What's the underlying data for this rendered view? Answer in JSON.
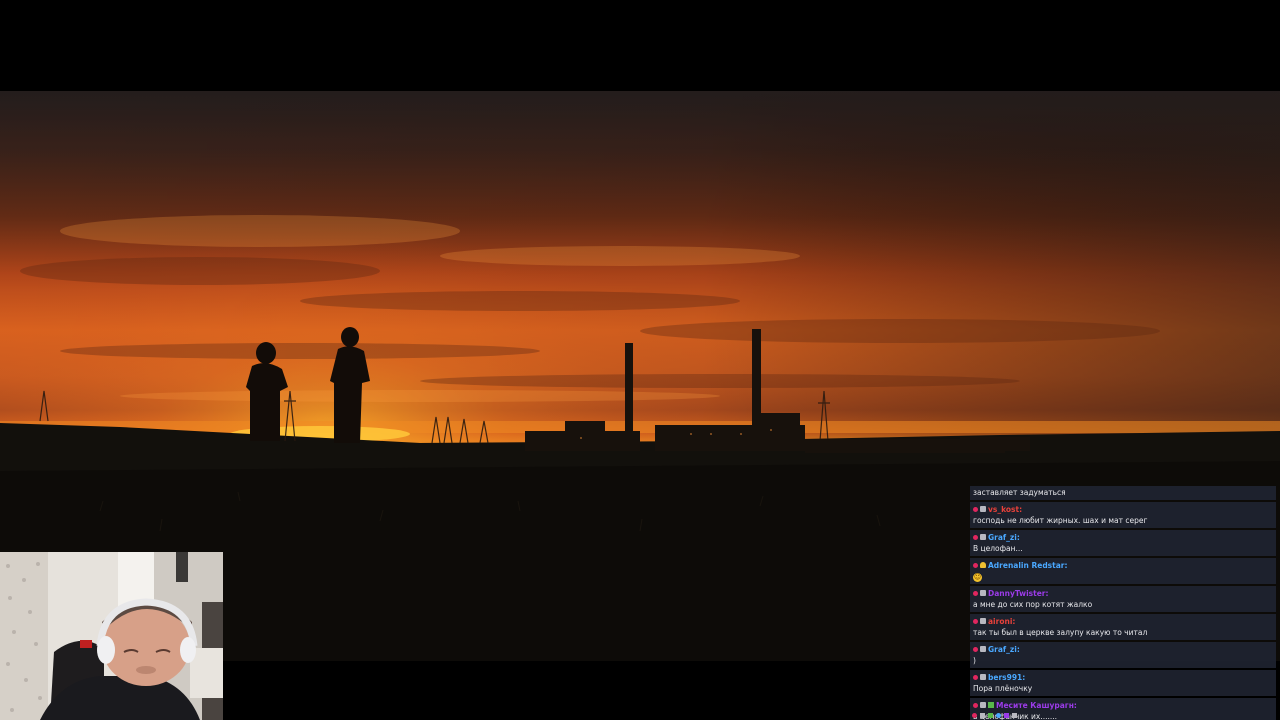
{
  "video": {
    "scene": "sunset-industrial"
  },
  "chat": {
    "messages": [
      {
        "user": "",
        "user_color": "#e8e8ec",
        "text": "заставляет задуматься",
        "badges": []
      },
      {
        "user": "vs_kost:",
        "user_color": "#e8413a",
        "text": "господь не любит жирных. шах и мат серег",
        "badges": [
          "dot",
          "sq"
        ]
      },
      {
        "user": "Graf_zi:",
        "user_color": "#4aa8ff",
        "text": "В целофан...",
        "badges": [
          "dot",
          "sq"
        ]
      },
      {
        "user": "Adrenalin Redstar:",
        "user_color": "#4aa8ff",
        "text": "",
        "emote": "😄",
        "badges": [
          "dot",
          "cap"
        ]
      },
      {
        "user": "DannyTwister:",
        "user_color": "#9b3be8",
        "text": "а мне до сих пор котят жалко",
        "badges": [
          "dot",
          "sq"
        ]
      },
      {
        "user": "aironi:",
        "user_color": "#e8413a",
        "text": "так ты был в церкве залупу какую то читал",
        "badges": [
          "dot",
          "sq"
        ]
      },
      {
        "user": "Graf_zi:",
        "user_color": "#4aa8ff",
        "text": ")",
        "badges": [
          "dot",
          "sq"
        ]
      },
      {
        "user": "bers991:",
        "user_color": "#4aa8ff",
        "text": "Пора плёночку",
        "badges": [
          "dot",
          "sq"
        ]
      },
      {
        "user": "Месите Кашурагн:",
        "user_color": "#9b3be8",
        "text": "в целофанчик их.......",
        "badges": [
          "dot",
          "sq",
          "green"
        ]
      }
    ]
  },
  "colors": {
    "chat_bg": "#202432",
    "badge_sub": "#e0265f",
    "sky_orange": "#d9621f"
  }
}
